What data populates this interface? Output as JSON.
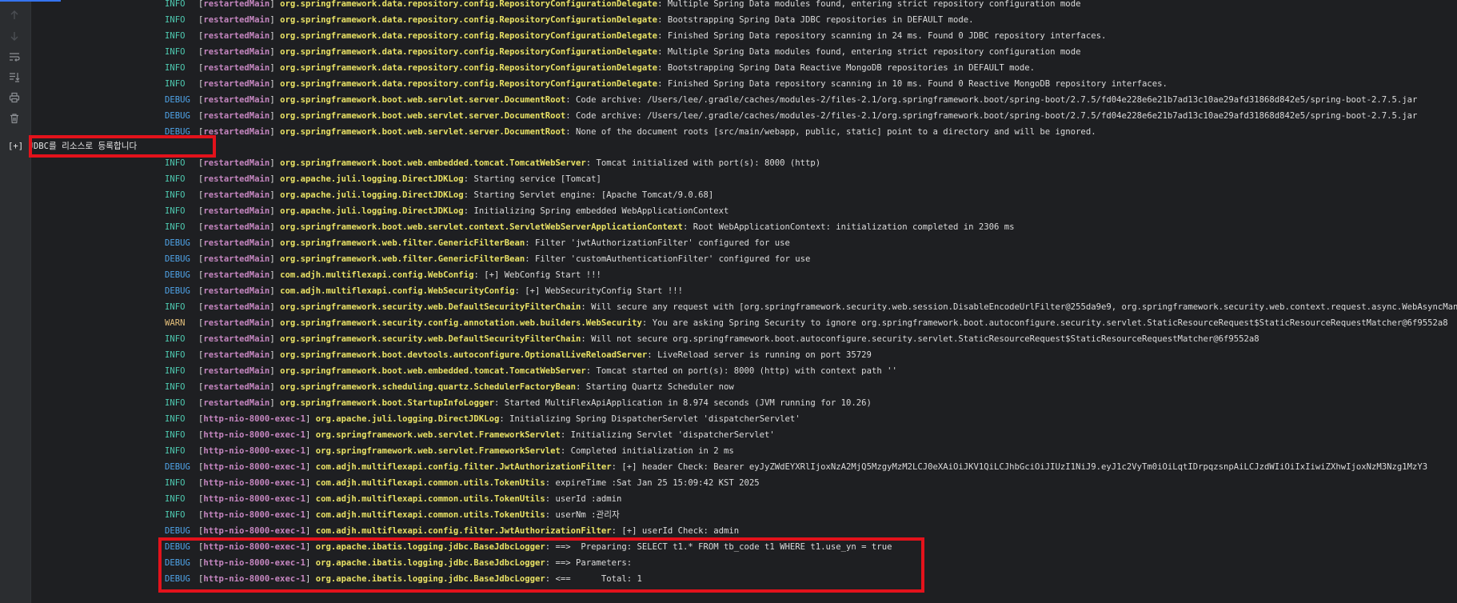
{
  "gutter": {
    "icons": [
      "up-arrow-icon",
      "down-arrow-icon",
      "soft-wrap-icon",
      "scroll-to-end-icon",
      "print-icon",
      "trash-icon"
    ]
  },
  "colors": {
    "INFO": "#4ec9b0",
    "DEBUG": "#4fa3e8",
    "WARN": "#e5c07b",
    "thread": "#c586c0",
    "logger": "#e9e265",
    "highlight": "#e3121b"
  },
  "plain_line": "[+] JDBC를 리소스로 등록합니다",
  "log_lines": [
    {
      "level": "INFO",
      "thread": "restartedMain",
      "logger": "org.springframework.data.repository.config.RepositoryConfigurationDelegate",
      "message": "Multiple Spring Data modules found, entering strict repository configuration mode"
    },
    {
      "level": "INFO",
      "thread": "restartedMain",
      "logger": "org.springframework.data.repository.config.RepositoryConfigurationDelegate",
      "message": "Bootstrapping Spring Data JDBC repositories in DEFAULT mode."
    },
    {
      "level": "INFO",
      "thread": "restartedMain",
      "logger": "org.springframework.data.repository.config.RepositoryConfigurationDelegate",
      "message": "Finished Spring Data repository scanning in 24 ms. Found 0 JDBC repository interfaces."
    },
    {
      "level": "INFO",
      "thread": "restartedMain",
      "logger": "org.springframework.data.repository.config.RepositoryConfigurationDelegate",
      "message": "Multiple Spring Data modules found, entering strict repository configuration mode"
    },
    {
      "level": "INFO",
      "thread": "restartedMain",
      "logger": "org.springframework.data.repository.config.RepositoryConfigurationDelegate",
      "message": "Bootstrapping Spring Data Reactive MongoDB repositories in DEFAULT mode."
    },
    {
      "level": "INFO",
      "thread": "restartedMain",
      "logger": "org.springframework.data.repository.config.RepositoryConfigurationDelegate",
      "message": "Finished Spring Data repository scanning in 10 ms. Found 0 Reactive MongoDB repository interfaces."
    },
    {
      "level": "DEBUG",
      "thread": "restartedMain",
      "logger": "org.springframework.boot.web.servlet.server.DocumentRoot",
      "message": "Code archive: /Users/lee/.gradle/caches/modules-2/files-2.1/org.springframework.boot/spring-boot/2.7.5/fd04e228e6e21b7ad13c10ae29afd31868d842e5/spring-boot-2.7.5.jar"
    },
    {
      "level": "DEBUG",
      "thread": "restartedMain",
      "logger": "org.springframework.boot.web.servlet.server.DocumentRoot",
      "message": "Code archive: /Users/lee/.gradle/caches/modules-2/files-2.1/org.springframework.boot/spring-boot/2.7.5/fd04e228e6e21b7ad13c10ae29afd31868d842e5/spring-boot-2.7.5.jar"
    },
    {
      "level": "DEBUG",
      "thread": "restartedMain",
      "logger": "org.springframework.boot.web.servlet.server.DocumentRoot",
      "message": "None of the document roots [src/main/webapp, public, static] point to a directory and will be ignored."
    },
    {
      "level": "INFO",
      "thread": "restartedMain",
      "logger": "org.springframework.boot.web.embedded.tomcat.TomcatWebServer",
      "message": "Tomcat initialized with port(s): 8000 (http)"
    },
    {
      "level": "INFO",
      "thread": "restartedMain",
      "logger": "org.apache.juli.logging.DirectJDKLog",
      "message": "Starting service [Tomcat]"
    },
    {
      "level": "INFO",
      "thread": "restartedMain",
      "logger": "org.apache.juli.logging.DirectJDKLog",
      "message": "Starting Servlet engine: [Apache Tomcat/9.0.68]"
    },
    {
      "level": "INFO",
      "thread": "restartedMain",
      "logger": "org.apache.juli.logging.DirectJDKLog",
      "message": "Initializing Spring embedded WebApplicationContext"
    },
    {
      "level": "INFO",
      "thread": "restartedMain",
      "logger": "org.springframework.boot.web.servlet.context.ServletWebServerApplicationContext",
      "message": "Root WebApplicationContext: initialization completed in 2306 ms"
    },
    {
      "level": "DEBUG",
      "thread": "restartedMain",
      "logger": "org.springframework.web.filter.GenericFilterBean",
      "message": "Filter 'jwtAuthorizationFilter' configured for use"
    },
    {
      "level": "DEBUG",
      "thread": "restartedMain",
      "logger": "org.springframework.web.filter.GenericFilterBean",
      "message": "Filter 'customAuthenticationFilter' configured for use"
    },
    {
      "level": "DEBUG",
      "thread": "restartedMain",
      "logger": "com.adjh.multiflexapi.config.WebConfig",
      "message": "[+] WebConfig Start !!!"
    },
    {
      "level": "DEBUG",
      "thread": "restartedMain",
      "logger": "com.adjh.multiflexapi.config.WebSecurityConfig",
      "message": "[+] WebSecurityConfig Start !!!"
    },
    {
      "level": "INFO",
      "thread": "restartedMain",
      "logger": "org.springframework.security.web.DefaultSecurityFilterChain",
      "message": "Will secure any request with [org.springframework.security.web.session.DisableEncodeUrlFilter@255da9e9, org.springframework.security.web.context.request.async.WebAsyncManagerIntegrationFilter"
    },
    {
      "level": "WARN",
      "thread": "restartedMain",
      "logger": "org.springframework.security.config.annotation.web.builders.WebSecurity",
      "message": "You are asking Spring Security to ignore org.springframework.boot.autoconfigure.security.servlet.StaticResourceRequest$StaticResourceRequestMatcher@6f9552a8"
    },
    {
      "level": "INFO",
      "thread": "restartedMain",
      "logger": "org.springframework.security.web.DefaultSecurityFilterChain",
      "message": "Will not secure org.springframework.boot.autoconfigure.security.servlet.StaticResourceRequest$StaticResourceRequestMatcher@6f9552a8"
    },
    {
      "level": "INFO",
      "thread": "restartedMain",
      "logger": "org.springframework.boot.devtools.autoconfigure.OptionalLiveReloadServer",
      "message": "LiveReload server is running on port 35729"
    },
    {
      "level": "INFO",
      "thread": "restartedMain",
      "logger": "org.springframework.boot.web.embedded.tomcat.TomcatWebServer",
      "message": "Tomcat started on port(s): 8000 (http) with context path ''"
    },
    {
      "level": "INFO",
      "thread": "restartedMain",
      "logger": "org.springframework.scheduling.quartz.SchedulerFactoryBean",
      "message": "Starting Quartz Scheduler now"
    },
    {
      "level": "INFO",
      "thread": "restartedMain",
      "logger": "org.springframework.boot.StartupInfoLogger",
      "message": "Started MultiFlexApiApplication in 8.974 seconds (JVM running for 10.26)"
    },
    {
      "level": "INFO",
      "thread": "http-nio-8000-exec-1",
      "logger": "org.apache.juli.logging.DirectJDKLog",
      "message": "Initializing Spring DispatcherServlet 'dispatcherServlet'"
    },
    {
      "level": "INFO",
      "thread": "http-nio-8000-exec-1",
      "logger": "org.springframework.web.servlet.FrameworkServlet",
      "message": "Initializing Servlet 'dispatcherServlet'"
    },
    {
      "level": "INFO",
      "thread": "http-nio-8000-exec-1",
      "logger": "org.springframework.web.servlet.FrameworkServlet",
      "message": "Completed initialization in 2 ms"
    },
    {
      "level": "DEBUG",
      "thread": "http-nio-8000-exec-1",
      "logger": "com.adjh.multiflexapi.config.filter.JwtAuthorizationFilter",
      "message": "[+] header Check: Bearer eyJyZWdEYXRlIjoxNzA2MjQ5MzgyMzM2LCJ0eXAiOiJKV1QiLCJhbGciOiJIUzI1NiJ9.eyJ1c2VyTm0iOiLqtIDrpqzsnpAiLCJzdWIiOiIxIiwiZXhwIjoxNzM3Nzg1MzY3"
    },
    {
      "level": "INFO",
      "thread": "http-nio-8000-exec-1",
      "logger": "com.adjh.multiflexapi.common.utils.TokenUtils",
      "message": "expireTime :Sat Jan 25 15:09:42 KST 2025"
    },
    {
      "level": "INFO",
      "thread": "http-nio-8000-exec-1",
      "logger": "com.adjh.multiflexapi.common.utils.TokenUtils",
      "message": "userId :admin"
    },
    {
      "level": "INFO",
      "thread": "http-nio-8000-exec-1",
      "logger": "com.adjh.multiflexapi.common.utils.TokenUtils",
      "message": "userNm :관리자"
    },
    {
      "level": "DEBUG",
      "thread": "http-nio-8000-exec-1",
      "logger": "com.adjh.multiflexapi.config.filter.JwtAuthorizationFilter",
      "message": "[+] userId Check: admin"
    },
    {
      "level": "DEBUG",
      "thread": "http-nio-8000-exec-1",
      "logger": "org.apache.ibatis.logging.jdbc.BaseJdbcLogger",
      "message": "==>  Preparing: SELECT t1.* FROM tb_code t1 WHERE t1.use_yn = true"
    },
    {
      "level": "DEBUG",
      "thread": "http-nio-8000-exec-1",
      "logger": "org.apache.ibatis.logging.jdbc.BaseJdbcLogger",
      "message": "==> Parameters: "
    },
    {
      "level": "DEBUG",
      "thread": "http-nio-8000-exec-1",
      "logger": "org.apache.ibatis.logging.jdbc.BaseJdbcLogger",
      "message": "<==      Total: 1"
    }
  ]
}
